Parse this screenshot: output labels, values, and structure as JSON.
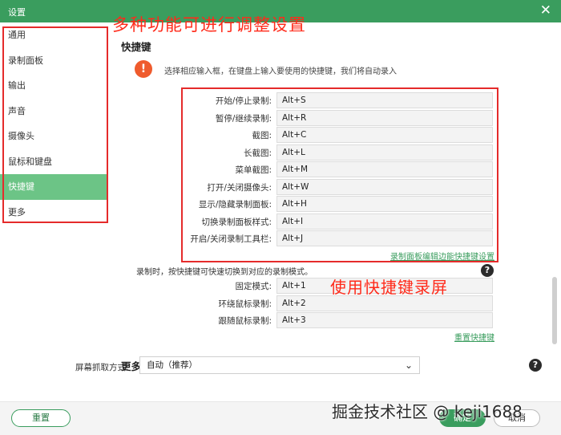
{
  "window": {
    "title": "设置"
  },
  "annotations": {
    "top": "多种功能可进行调整设置",
    "middle": "使用快捷键录屏"
  },
  "sidebar": {
    "items": [
      {
        "label": "通用",
        "active": false
      },
      {
        "label": "录制面板",
        "active": false
      },
      {
        "label": "输出",
        "active": false
      },
      {
        "label": "声音",
        "active": false
      },
      {
        "label": "摄像头",
        "active": false
      },
      {
        "label": "鼠标和键盘",
        "active": false
      },
      {
        "label": "快捷键",
        "active": true
      },
      {
        "label": "更多",
        "active": false
      }
    ]
  },
  "shortcuts": {
    "title": "快捷键",
    "hint": "选择相应输入框，在键盘上输入要使用的快捷键，我们将自动录入",
    "items": [
      {
        "label": "开始/停止录制:",
        "value": "Alt+S"
      },
      {
        "label": "暂停/继续录制:",
        "value": "Alt+R"
      },
      {
        "label": "截图:",
        "value": "Alt+C"
      },
      {
        "label": "长截图:",
        "value": "Alt+L"
      },
      {
        "label": "菜单截图:",
        "value": "Alt+M"
      },
      {
        "label": "打开/关闭摄像头:",
        "value": "Alt+W"
      },
      {
        "label": "显示/隐藏录制面板:",
        "value": "Alt+H"
      },
      {
        "label": "切换录制面板样式:",
        "value": "Alt+I"
      },
      {
        "label": "开启/关闭录制工具栏:",
        "value": "Alt+J"
      }
    ],
    "panel_link": "录制面板编辑边能快捷键设置",
    "mode_note": "录制时，按快捷键可快速切换到对应的录制模式。",
    "modes": [
      {
        "label": "固定模式:",
        "value": "Alt+1"
      },
      {
        "label": "环绕鼠标录制:",
        "value": "Alt+2"
      },
      {
        "label": "跟随鼠标录制:",
        "value": "Alt+3"
      }
    ],
    "reset_link": "重置快捷键"
  },
  "more": {
    "title": "更多",
    "capture_label": "屏幕抓取方式:",
    "capture_value": "自动（推荐）"
  },
  "footer": {
    "reset": "重置",
    "confirm": "确定",
    "cancel": "取消"
  },
  "watermark": "掘金技术社区 @ keji1688",
  "icons": {
    "close": "close-icon",
    "warning": "exclamation-icon",
    "help": "question-icon",
    "chevron": "chevron-down-icon"
  },
  "colors": {
    "accent": "#3a9d5e",
    "active_item": "#6cc486",
    "annotation": "#e52b2b",
    "warning": "#ef5b2d"
  }
}
